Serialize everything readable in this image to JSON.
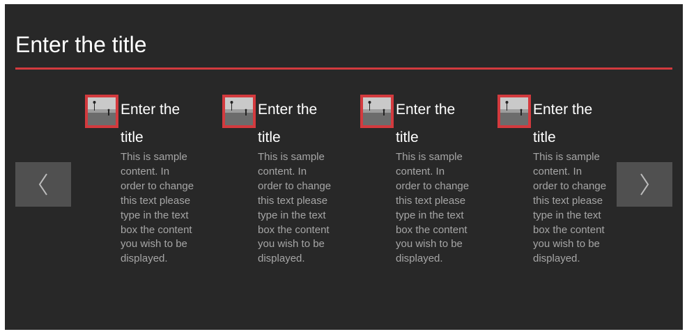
{
  "header": {
    "title": "Enter the title"
  },
  "carousel": {
    "prev_icon": "chevron-left-icon",
    "next_icon": "chevron-right-icon",
    "items": [
      {
        "title": "Enter the title",
        "text": "This is sample content. In order to change this text please type in the text box the content you wish to be displayed."
      },
      {
        "title": "Enter the title",
        "text": "This is sample content. In order to change this text please type in the text box the content you wish to be displayed."
      },
      {
        "title": "Enter the title",
        "text": "This is sample content. In order to change this text please type in the text box the content you wish to be displayed."
      },
      {
        "title": "Enter the title",
        "text": "This is sample content. In order to change this text please type in the text box the content you wish to be displayed."
      }
    ]
  },
  "colors": {
    "background": "#282828",
    "accent": "#d33a3e",
    "title_text": "#ffffff",
    "body_text": "#a6a6a6",
    "nav_button": "#505050"
  }
}
